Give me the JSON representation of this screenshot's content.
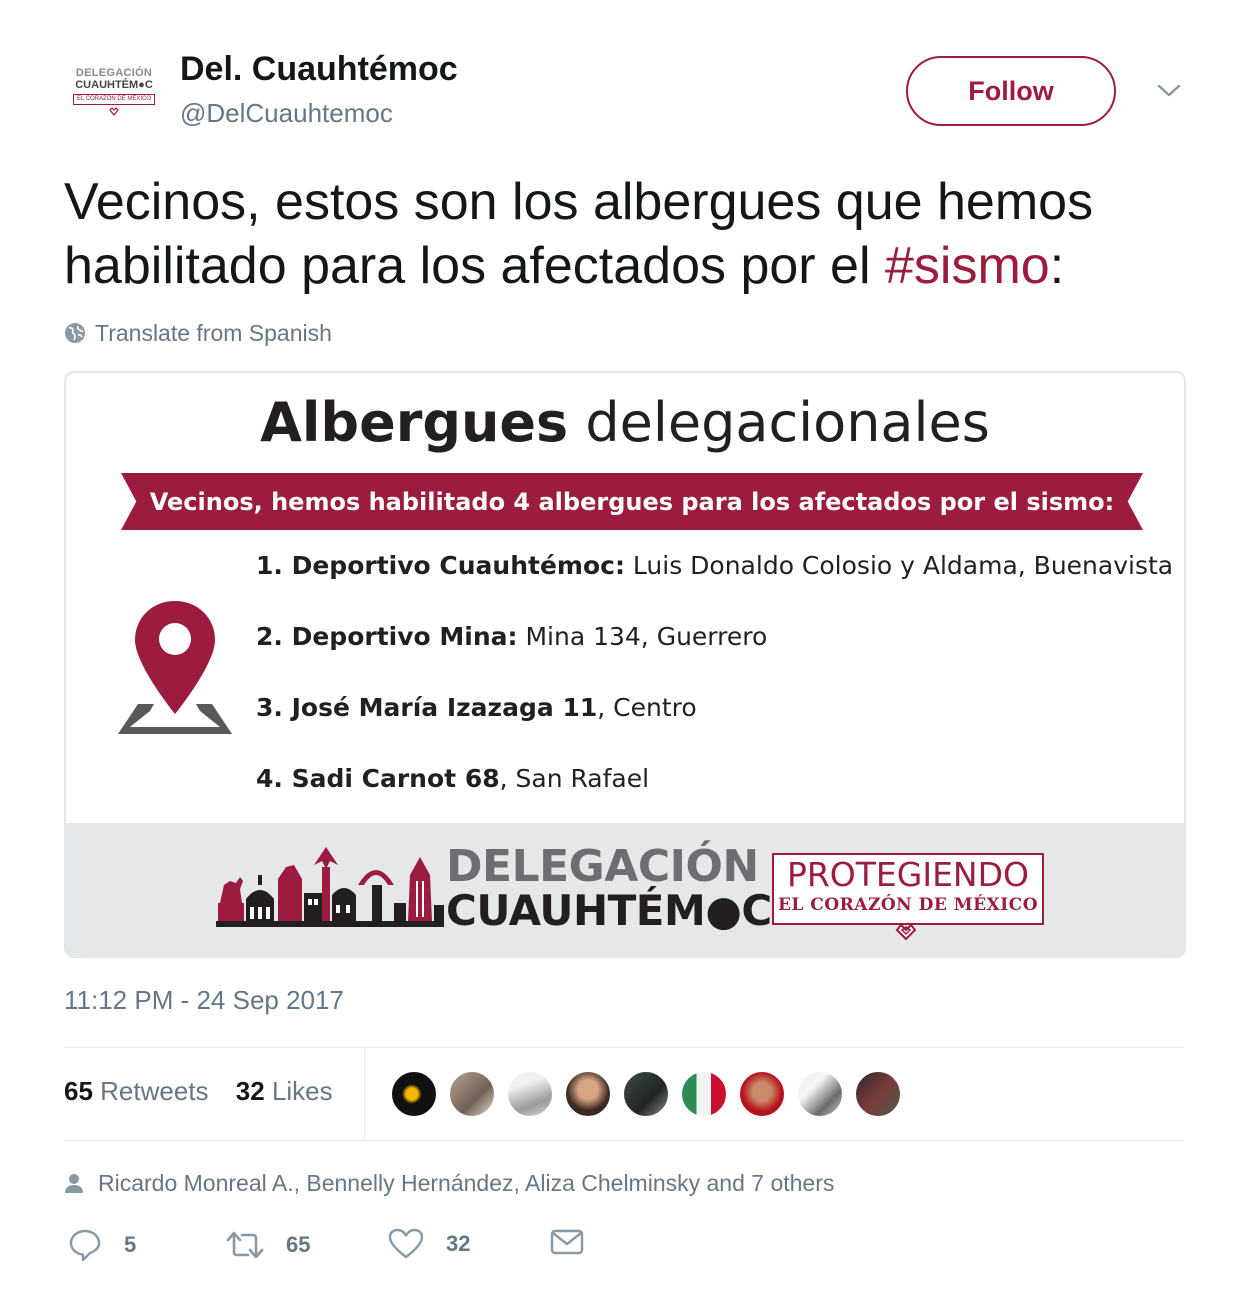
{
  "account": {
    "avatar_line1": "DELEGACIÓN",
    "avatar_line2": "CUAUHTÉM●C",
    "avatar_line3": "EL CORAZÓN DE MÉXICO",
    "display_name": "Del. Cuauhtémoc",
    "handle": "@DelCuauhtemoc"
  },
  "follow_label": "Follow",
  "tweet": {
    "text_before": "Vecinos, estos son los albergues que hemos habilitado para los afectados por el ",
    "hashtag": "#sismo",
    "text_after": ":",
    "translate_label": "Translate from Spanish"
  },
  "card": {
    "title_bold": "Albergues",
    "title_rest": " delegacionales",
    "banner": "Vecinos, hemos habilitado 4 albergues para los afectados por el sismo:",
    "items": [
      {
        "bold": "1. Deportivo Cuauhtémoc:",
        "rest": " Luis Donaldo Colosio y Aldama, Buenavista"
      },
      {
        "bold": "2. Deportivo Mina:",
        "rest": " Mina 134, Guerrero"
      },
      {
        "bold": "3. José María Izazaga 11",
        "rest": ", Centro"
      },
      {
        "bold": "4. Sadi Carnot 68",
        "rest": ", San Rafael"
      }
    ],
    "logo_line1": "DELEGACIÓN",
    "logo_line2": "CUAUHTÉM●C",
    "slogan_line1": "PROTEGIENDO",
    "slogan_line2": "EL CORAZÓN DE MÉXICO"
  },
  "timestamp": "11:12 PM - 24 Sep 2017",
  "stats": {
    "retweets_count": "65",
    "retweets_label": "Retweets",
    "likes_count": "32",
    "likes_label": "Likes"
  },
  "liked_by": "Ricardo Monreal A., Bennelly Hernández, Aliza Chelminsky and 7 others",
  "actions": {
    "reply_count": "5",
    "retweet_count": "65",
    "like_count": "32"
  },
  "colors": {
    "brand": "#9b1c3e",
    "muted": "#657786"
  }
}
